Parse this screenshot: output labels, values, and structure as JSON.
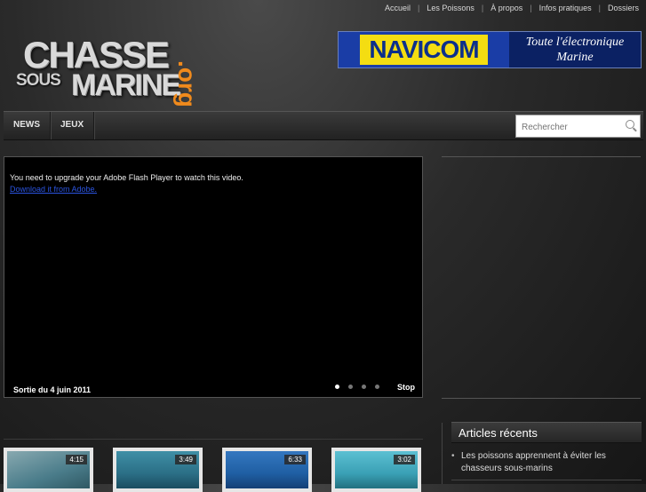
{
  "topnav": {
    "items": [
      "Accueil",
      "Les Poissons",
      "À propos",
      "Infos pratiques",
      "Dossiers"
    ]
  },
  "logo": {
    "line1": "CHASSE",
    "sous": "SOUS",
    "line2": "MARINE",
    "suffix": ".org"
  },
  "banner": {
    "brand": "NAVICOM",
    "tagline1": "Toute l'électronique",
    "tagline2": "Marine",
    "brand_color": "#f4dd12",
    "bg_color": "#0d2a7a"
  },
  "menu": {
    "items": [
      "NEWS",
      "JEUX"
    ]
  },
  "search": {
    "placeholder": "Rechercher",
    "icon": "magnifier-icon"
  },
  "video": {
    "message": "You need to upgrade your Adobe Flash Player to watch this video.",
    "download_link": "Download it from Adobe.",
    "caption": "Sortie du 4 juin 2011",
    "slides_total": 4,
    "active_slide": 1,
    "stop_label": "Stop"
  },
  "sidebar": {
    "recent_title": "Articles récents",
    "recent_items": [
      "Les poissons apprennent à éviter les chasseurs sous-marins"
    ]
  },
  "thumbnails": [
    {
      "duration": "4:15",
      "color": "#4a7c8a"
    },
    {
      "duration": "3:49",
      "color": "#2b6f86"
    },
    {
      "duration": "6:33",
      "color": "#1f5fa3"
    },
    {
      "duration": "3:02",
      "color": "#3aa0b5"
    }
  ],
  "colors": {
    "accent_orange": "#f08a1c",
    "link_blue": "#2b54e0"
  }
}
